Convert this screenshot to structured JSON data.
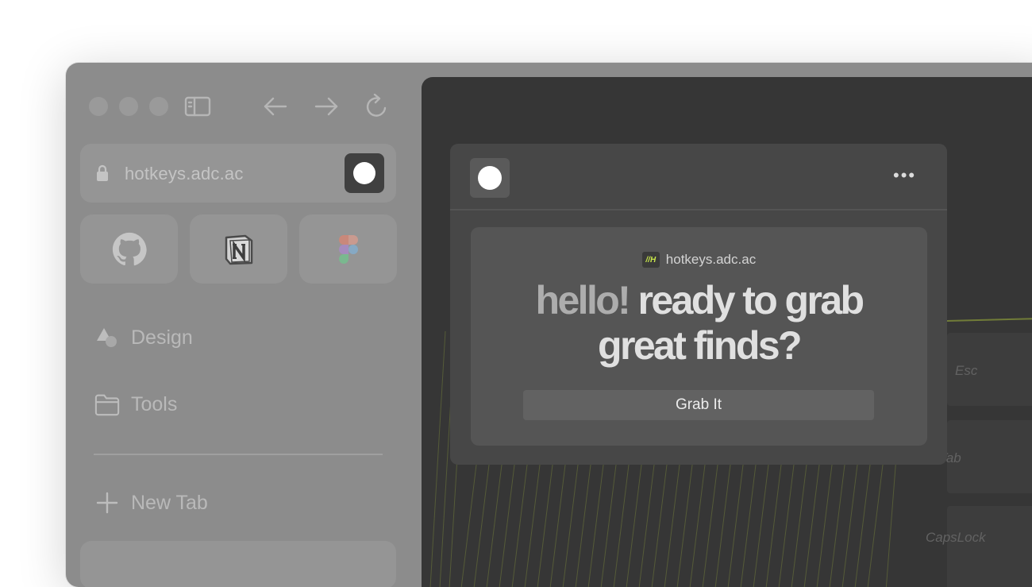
{
  "sidebar": {
    "address": "hotkeys.adc.ac",
    "items": [
      {
        "label": "Design",
        "icon": "shapes-icon"
      },
      {
        "label": "Tools",
        "icon": "folder-icon"
      }
    ],
    "new_tab_label": "New Tab",
    "favorites": [
      {
        "name": "github",
        "icon": "github-icon"
      },
      {
        "name": "notion",
        "icon": "notion-icon"
      },
      {
        "name": "figma",
        "icon": "figma-icon"
      }
    ]
  },
  "popup": {
    "site": "hotkeys.adc.ac",
    "site_logo": "//H",
    "headline_dim": "hello!",
    "headline_rest": "ready to grab",
    "headline_line2": "great finds?",
    "button_label": "Grab It",
    "more_label": "•••"
  },
  "background_keys": {
    "esc": "Esc",
    "tab": "Tab",
    "capslock": "CapsLock"
  },
  "colors": {
    "window": "#8c8c8c",
    "content": "#363636",
    "popup": "#474747",
    "card": "#555555",
    "accent_lines": "#8a9a3a"
  }
}
